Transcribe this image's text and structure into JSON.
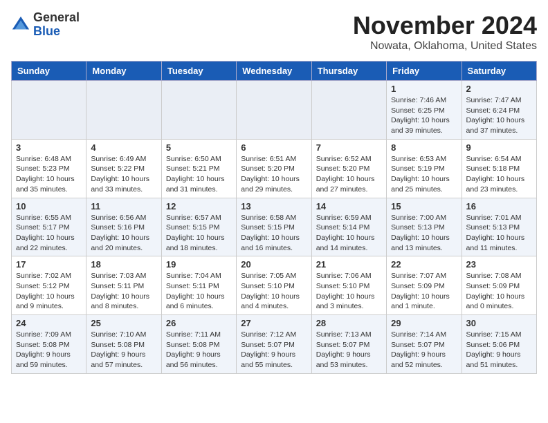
{
  "logo": {
    "general": "General",
    "blue": "Blue"
  },
  "title": "November 2024",
  "location": "Nowata, Oklahoma, United States",
  "days_of_week": [
    "Sunday",
    "Monday",
    "Tuesday",
    "Wednesday",
    "Thursday",
    "Friday",
    "Saturday"
  ],
  "weeks": [
    [
      {
        "day": "",
        "info": ""
      },
      {
        "day": "",
        "info": ""
      },
      {
        "day": "",
        "info": ""
      },
      {
        "day": "",
        "info": ""
      },
      {
        "day": "",
        "info": ""
      },
      {
        "day": "1",
        "info": "Sunrise: 7:46 AM\nSunset: 6:25 PM\nDaylight: 10 hours\nand 39 minutes."
      },
      {
        "day": "2",
        "info": "Sunrise: 7:47 AM\nSunset: 6:24 PM\nDaylight: 10 hours\nand 37 minutes."
      }
    ],
    [
      {
        "day": "3",
        "info": "Sunrise: 6:48 AM\nSunset: 5:23 PM\nDaylight: 10 hours\nand 35 minutes."
      },
      {
        "day": "4",
        "info": "Sunrise: 6:49 AM\nSunset: 5:22 PM\nDaylight: 10 hours\nand 33 minutes."
      },
      {
        "day": "5",
        "info": "Sunrise: 6:50 AM\nSunset: 5:21 PM\nDaylight: 10 hours\nand 31 minutes."
      },
      {
        "day": "6",
        "info": "Sunrise: 6:51 AM\nSunset: 5:20 PM\nDaylight: 10 hours\nand 29 minutes."
      },
      {
        "day": "7",
        "info": "Sunrise: 6:52 AM\nSunset: 5:20 PM\nDaylight: 10 hours\nand 27 minutes."
      },
      {
        "day": "8",
        "info": "Sunrise: 6:53 AM\nSunset: 5:19 PM\nDaylight: 10 hours\nand 25 minutes."
      },
      {
        "day": "9",
        "info": "Sunrise: 6:54 AM\nSunset: 5:18 PM\nDaylight: 10 hours\nand 23 minutes."
      }
    ],
    [
      {
        "day": "10",
        "info": "Sunrise: 6:55 AM\nSunset: 5:17 PM\nDaylight: 10 hours\nand 22 minutes."
      },
      {
        "day": "11",
        "info": "Sunrise: 6:56 AM\nSunset: 5:16 PM\nDaylight: 10 hours\nand 20 minutes."
      },
      {
        "day": "12",
        "info": "Sunrise: 6:57 AM\nSunset: 5:15 PM\nDaylight: 10 hours\nand 18 minutes."
      },
      {
        "day": "13",
        "info": "Sunrise: 6:58 AM\nSunset: 5:15 PM\nDaylight: 10 hours\nand 16 minutes."
      },
      {
        "day": "14",
        "info": "Sunrise: 6:59 AM\nSunset: 5:14 PM\nDaylight: 10 hours\nand 14 minutes."
      },
      {
        "day": "15",
        "info": "Sunrise: 7:00 AM\nSunset: 5:13 PM\nDaylight: 10 hours\nand 13 minutes."
      },
      {
        "day": "16",
        "info": "Sunrise: 7:01 AM\nSunset: 5:13 PM\nDaylight: 10 hours\nand 11 minutes."
      }
    ],
    [
      {
        "day": "17",
        "info": "Sunrise: 7:02 AM\nSunset: 5:12 PM\nDaylight: 10 hours\nand 9 minutes."
      },
      {
        "day": "18",
        "info": "Sunrise: 7:03 AM\nSunset: 5:11 PM\nDaylight: 10 hours\nand 8 minutes."
      },
      {
        "day": "19",
        "info": "Sunrise: 7:04 AM\nSunset: 5:11 PM\nDaylight: 10 hours\nand 6 minutes."
      },
      {
        "day": "20",
        "info": "Sunrise: 7:05 AM\nSunset: 5:10 PM\nDaylight: 10 hours\nand 4 minutes."
      },
      {
        "day": "21",
        "info": "Sunrise: 7:06 AM\nSunset: 5:10 PM\nDaylight: 10 hours\nand 3 minutes."
      },
      {
        "day": "22",
        "info": "Sunrise: 7:07 AM\nSunset: 5:09 PM\nDaylight: 10 hours\nand 1 minute."
      },
      {
        "day": "23",
        "info": "Sunrise: 7:08 AM\nSunset: 5:09 PM\nDaylight: 10 hours\nand 0 minutes."
      }
    ],
    [
      {
        "day": "24",
        "info": "Sunrise: 7:09 AM\nSunset: 5:08 PM\nDaylight: 9 hours\nand 59 minutes."
      },
      {
        "day": "25",
        "info": "Sunrise: 7:10 AM\nSunset: 5:08 PM\nDaylight: 9 hours\nand 57 minutes."
      },
      {
        "day": "26",
        "info": "Sunrise: 7:11 AM\nSunset: 5:08 PM\nDaylight: 9 hours\nand 56 minutes."
      },
      {
        "day": "27",
        "info": "Sunrise: 7:12 AM\nSunset: 5:07 PM\nDaylight: 9 hours\nand 55 minutes."
      },
      {
        "day": "28",
        "info": "Sunrise: 7:13 AM\nSunset: 5:07 PM\nDaylight: 9 hours\nand 53 minutes."
      },
      {
        "day": "29",
        "info": "Sunrise: 7:14 AM\nSunset: 5:07 PM\nDaylight: 9 hours\nand 52 minutes."
      },
      {
        "day": "30",
        "info": "Sunrise: 7:15 AM\nSunset: 5:06 PM\nDaylight: 9 hours\nand 51 minutes."
      }
    ]
  ],
  "colors": {
    "header_bg": "#1a5cb5",
    "header_text": "#ffffff",
    "border": "#cccccc",
    "alt_row": "#f0f4fa"
  }
}
